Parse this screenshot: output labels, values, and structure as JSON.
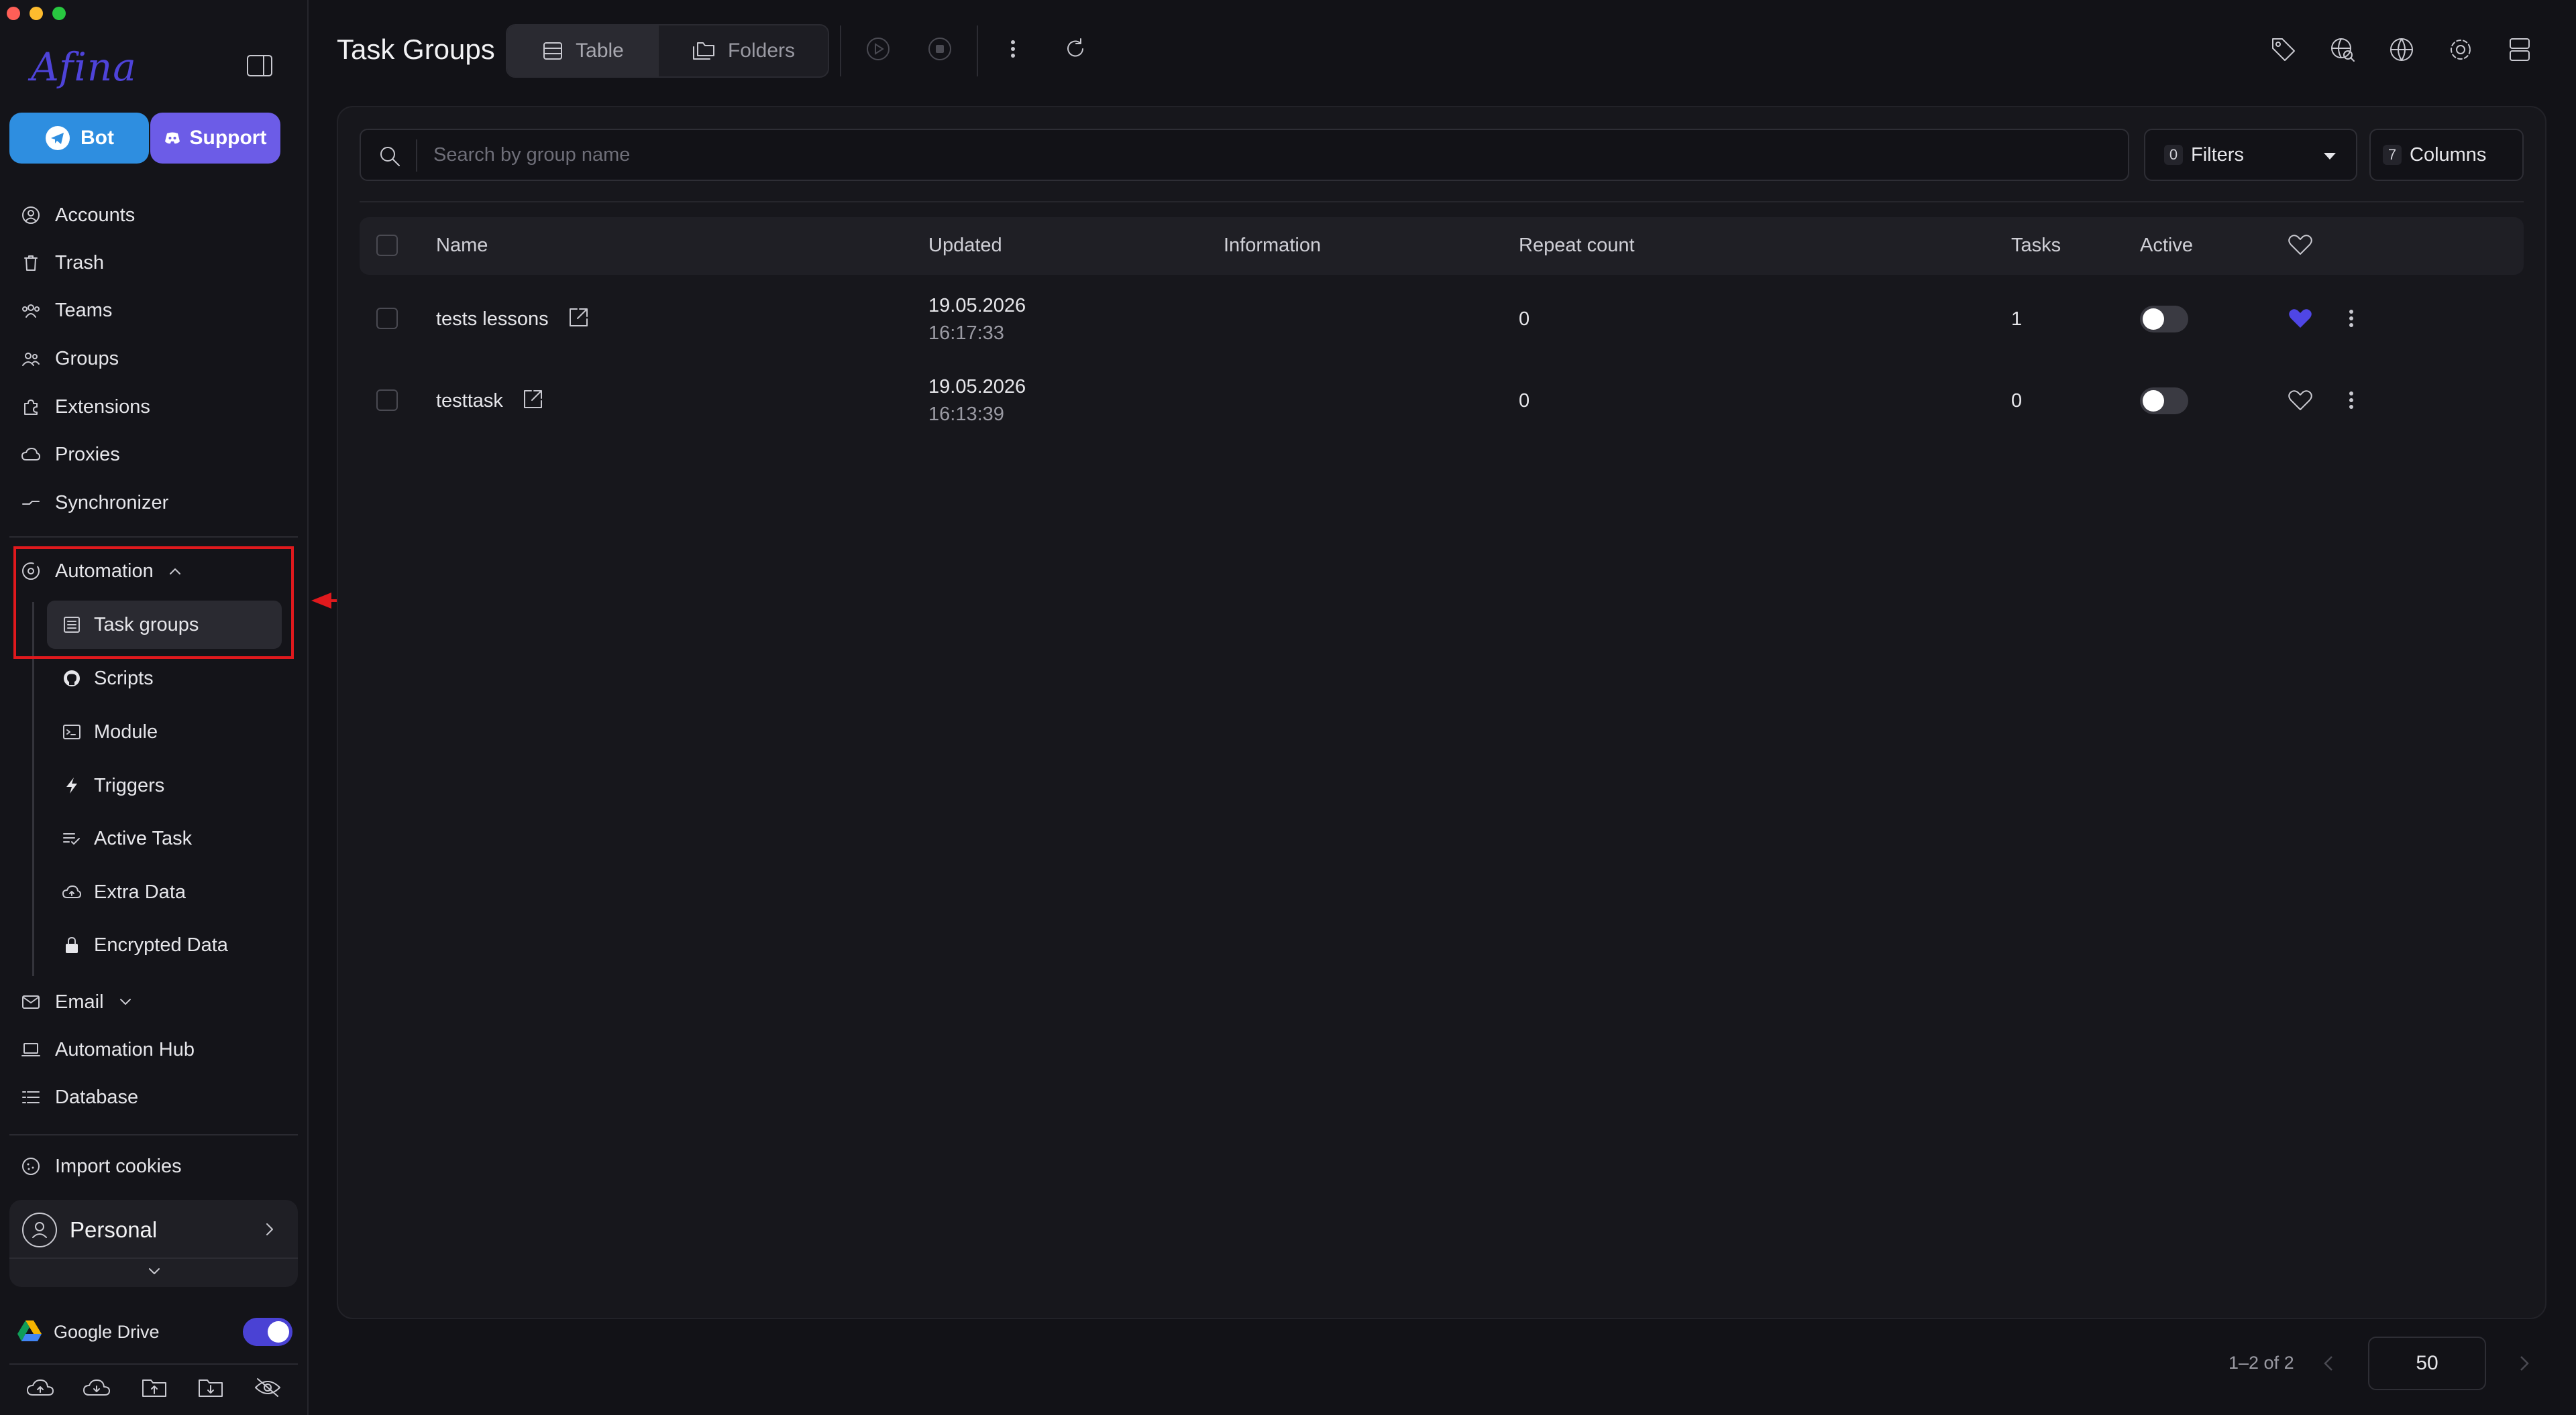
{
  "window": {
    "traffic_lights": [
      "#ff5f57",
      "#febc2e",
      "#28c840"
    ]
  },
  "brand": {
    "logo_text": "Afina",
    "logo_color": "#4e43d9"
  },
  "sidebar": {
    "bot_button": {
      "label": "Bot",
      "icon": "telegram-icon",
      "color": "#2e8ee0"
    },
    "support_button": {
      "label": "Support",
      "icon": "discord-icon",
      "color": "#6c5ce7"
    },
    "items": [
      {
        "label": "Accounts",
        "icon": "user-circle-icon"
      },
      {
        "label": "Trash",
        "icon": "trash-icon"
      },
      {
        "label": "Teams",
        "icon": "team-icon"
      },
      {
        "label": "Groups",
        "icon": "users-icon"
      },
      {
        "label": "Extensions",
        "icon": "puzzle-icon"
      },
      {
        "label": "Proxies",
        "icon": "cloud-icon"
      },
      {
        "label": "Synchronizer",
        "icon": "sync-icon"
      }
    ],
    "automation": {
      "label": "Automation",
      "expanded": true,
      "children": [
        {
          "label": "Task groups",
          "icon": "list-icon",
          "active": true
        },
        {
          "label": "Scripts",
          "icon": "github-icon"
        },
        {
          "label": "Module",
          "icon": "terminal-icon"
        },
        {
          "label": "Triggers",
          "icon": "lightning-icon"
        },
        {
          "label": "Active Task",
          "icon": "list-check-icon"
        },
        {
          "label": "Extra Data",
          "icon": "cloud-upload-icon"
        },
        {
          "label": "Encrypted Data",
          "icon": "lock-icon"
        }
      ]
    },
    "email": {
      "label": "Email",
      "icon": "mail-icon"
    },
    "automation_hub": {
      "label": "Automation Hub",
      "icon": "laptop-icon"
    },
    "database": {
      "label": "Database",
      "icon": "database-icon"
    },
    "import_cookies": {
      "label": "Import cookies",
      "icon": "cookie-icon"
    },
    "workspace": {
      "label": "Personal"
    },
    "google_drive": {
      "label": "Google Drive",
      "enabled": true,
      "toggle_color": "#4a42d4"
    }
  },
  "header": {
    "title": "Task Groups",
    "view_tabs": [
      {
        "label": "Table",
        "active": true
      },
      {
        "label": "Folders",
        "active": false
      }
    ]
  },
  "toolbar": {
    "search_placeholder": "Search by group name",
    "filters": {
      "count": "0",
      "label": "Filters"
    },
    "columns": {
      "count": "7",
      "label": "Columns"
    }
  },
  "table": {
    "columns": [
      "Name",
      "Updated",
      "Information",
      "Repeat count",
      "Tasks",
      "Active"
    ],
    "rows": [
      {
        "name": "tests lessons",
        "updated_date": "19.05.2026",
        "updated_time": "16:17:33",
        "information": "",
        "repeat_count": "0",
        "tasks": "1",
        "active": false,
        "favorite": true
      },
      {
        "name": "testtask",
        "updated_date": "19.05.2026",
        "updated_time": "16:13:39",
        "information": "",
        "repeat_count": "0",
        "tasks": "0",
        "active": false,
        "favorite": false
      }
    ],
    "favorite_color": "#4f46e5"
  },
  "pagination": {
    "range_text": "1–2 of 2",
    "page_size": "50"
  },
  "annotation": {
    "color": "#e0191d"
  }
}
